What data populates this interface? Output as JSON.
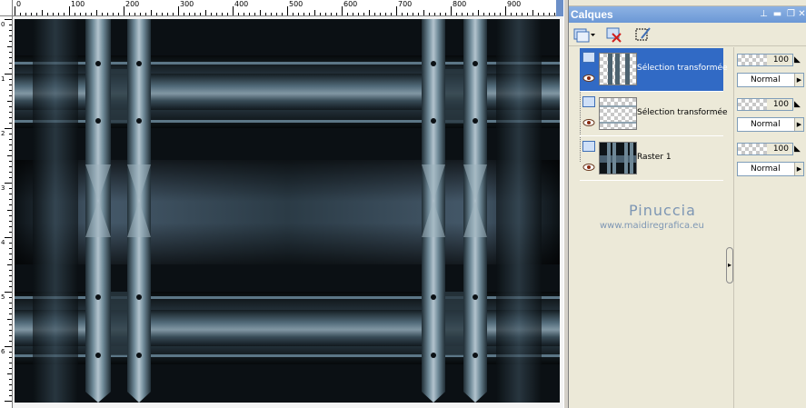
{
  "rulers": {
    "top_labels": [
      "0",
      "100",
      "200",
      "300",
      "400",
      "500",
      "600",
      "700",
      "800",
      "900"
    ],
    "left_labels": [
      "0",
      "1",
      "2",
      "3",
      "4",
      "5",
      "6"
    ]
  },
  "panel": {
    "title": "Calques",
    "title_buttons": [
      "pin-icon",
      "minimize-icon",
      "restore-icon",
      "close-icon"
    ]
  },
  "toolbar": {
    "tools": [
      "new-layer-icon",
      "delete-layer-icon",
      "edit-selection-icon"
    ]
  },
  "layers": [
    {
      "name": "Sélection transformée",
      "opacity": "100",
      "blend": "Normal",
      "selected": true,
      "thumb": "checker-bars"
    },
    {
      "name": "Sélection transformée",
      "opacity": "100",
      "blend": "Normal",
      "selected": false,
      "thumb": "checker"
    },
    {
      "name": "Raster 1",
      "opacity": "100",
      "blend": "Normal",
      "selected": false,
      "thumb": "dark-pattern"
    }
  ],
  "watermark": {
    "name": "Pinuccia",
    "url": "www.maidiregrafica.eu"
  },
  "colors": {
    "selection": "#316ac5",
    "title_bar": "#7aa2dc",
    "canvas_dark": "#0b1014",
    "steel": "#5d7888"
  }
}
